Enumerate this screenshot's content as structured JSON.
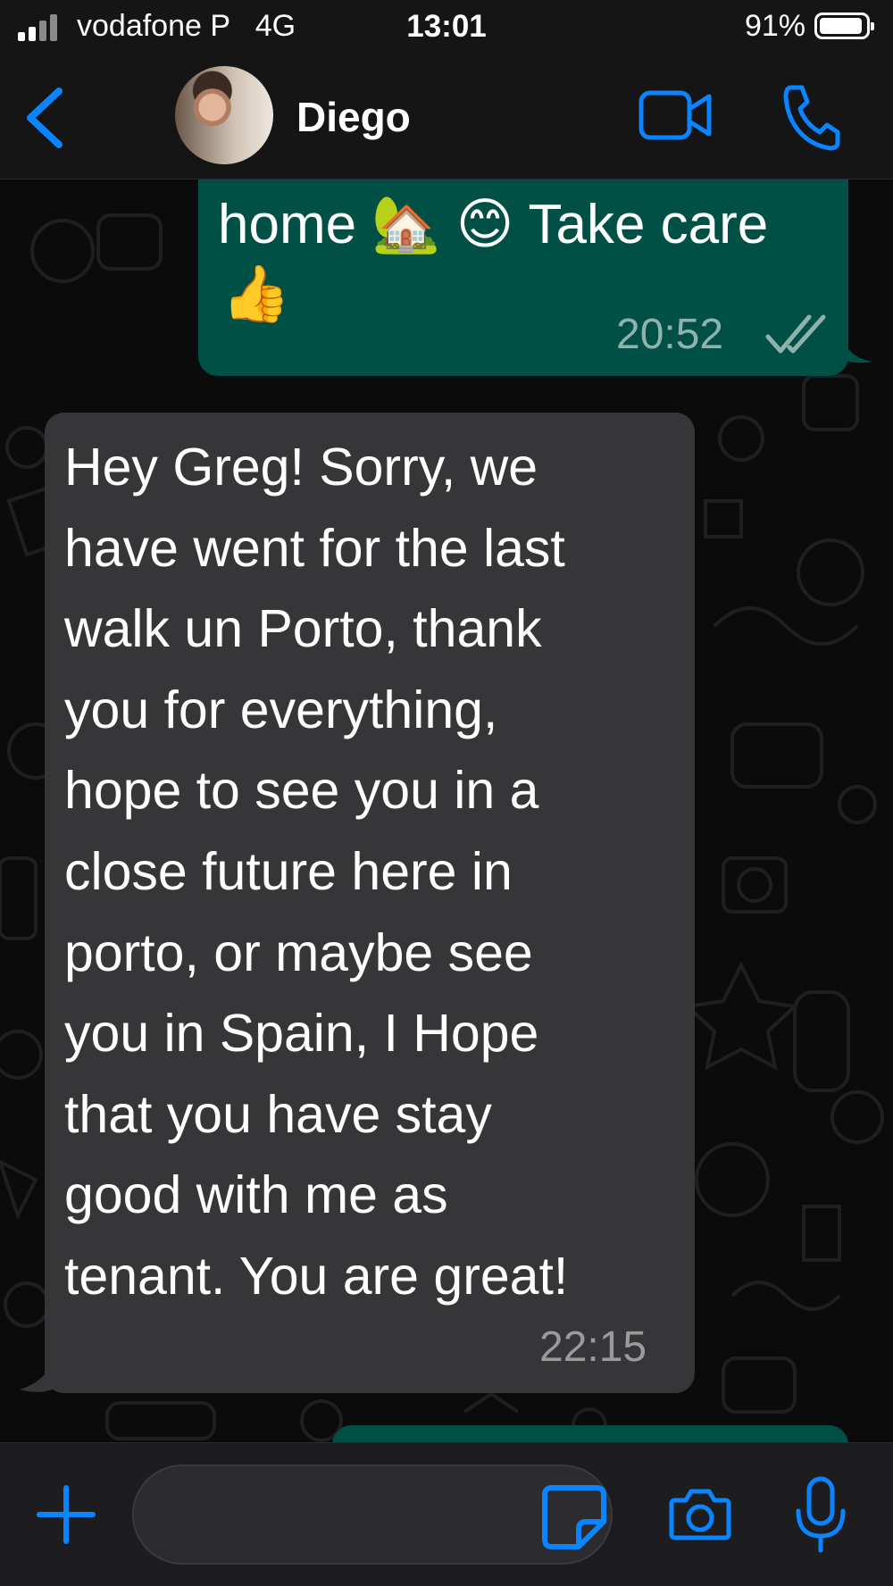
{
  "status_bar": {
    "carrier": "vodafone P",
    "network": "4G",
    "time": "13:01",
    "battery_percent": "91%"
  },
  "header": {
    "contact_name": "Diego",
    "back_icon": "chevron-left-icon",
    "video_icon": "video-camera-icon",
    "call_icon": "phone-icon"
  },
  "messages": [
    {
      "direction": "outgoing",
      "line1": "home 🏡 😊 Take care",
      "line2": "👍",
      "time": "20:52",
      "status_icon": "double-check-icon"
    },
    {
      "direction": "incoming",
      "text": "Hey Greg! Sorry, we\nhave went for the last\nwalk un Porto, thank\nyou for everything,\nhope to see you in a\nclose future here in\nporto, or maybe see\nyou in Spain, I Hope\nthat you have stay\ngood with me as\ntenant. You are great!",
      "time": "22:15"
    }
  ],
  "input_bar": {
    "message_value": "",
    "plus_icon": "plus-icon",
    "sticker_icon": "sticker-icon",
    "camera_icon": "camera-icon",
    "mic_icon": "microphone-icon"
  },
  "colors": {
    "accent": "#0a84ff",
    "outgoing_bubble": "#005045",
    "incoming_bubble": "#363638",
    "background": "#0b0b0c"
  }
}
